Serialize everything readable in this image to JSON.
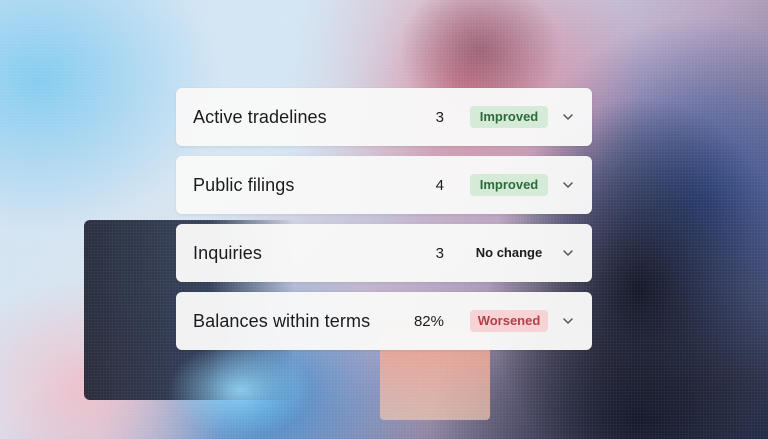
{
  "colors": {
    "improved_bg": "#d6ead8",
    "improved_text": "#2c6b3a",
    "worsened_bg": "#f7d3d5",
    "worsened_text": "#b43f4a"
  },
  "rows": [
    {
      "label": "Active tradelines",
      "value": "3",
      "status": "Improved",
      "status_type": "improved",
      "icon": "chevron-down-icon"
    },
    {
      "label": "Public filings",
      "value": "4",
      "status": "Improved",
      "status_type": "improved",
      "icon": "chevron-down-icon"
    },
    {
      "label": "Inquiries",
      "value": "3",
      "status": "No change",
      "status_type": "neutral",
      "icon": "chevron-down-icon"
    },
    {
      "label": "Balances within terms",
      "value": "82%",
      "status": "Worsened",
      "status_type": "worsened",
      "icon": "chevron-down-icon"
    }
  ]
}
